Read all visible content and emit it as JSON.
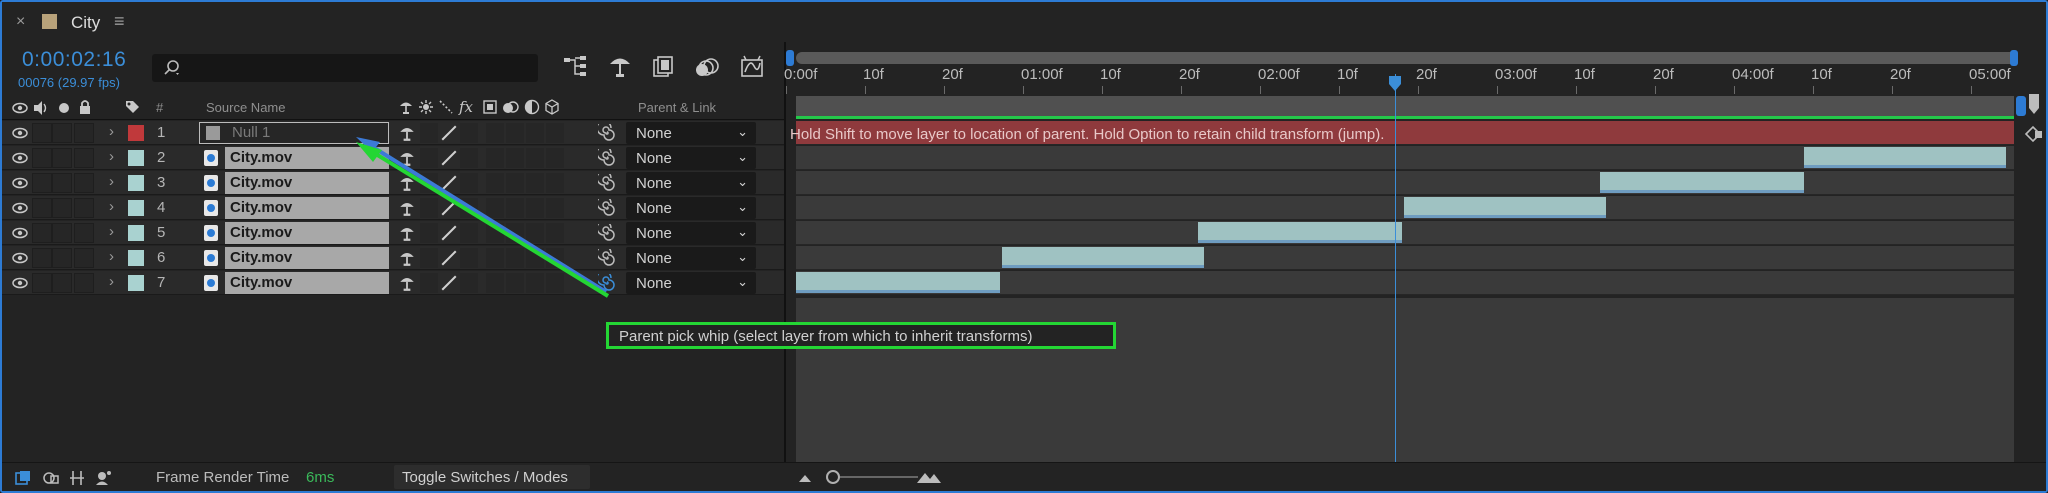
{
  "tab": {
    "close_glyph": "×",
    "title": "City",
    "menu_glyph": "≡",
    "swatch_color": "#b8a27a"
  },
  "timecode": {
    "time": "0:00:02:16",
    "frames_fps": "00076 (29.97 fps)"
  },
  "search": {
    "placeholder": ""
  },
  "columns": {
    "number": "#",
    "source_name": "Source Name",
    "parent_link": "Parent & Link"
  },
  "layers": [
    {
      "num": "1",
      "name": "Null 1",
      "label_color": "#c0393b",
      "type": "null",
      "parent": "None"
    },
    {
      "num": "2",
      "name": "City.mov",
      "label_color": "#a9d2d0",
      "type": "footage",
      "parent": "None"
    },
    {
      "num": "3",
      "name": "City.mov",
      "label_color": "#a9d2d0",
      "type": "footage",
      "parent": "None"
    },
    {
      "num": "4",
      "name": "City.mov",
      "label_color": "#a9d2d0",
      "type": "footage",
      "parent": "None"
    },
    {
      "num": "5",
      "name": "City.mov",
      "label_color": "#a9d2d0",
      "type": "footage",
      "parent": "None"
    },
    {
      "num": "6",
      "name": "City.mov",
      "label_color": "#a9d2d0",
      "type": "footage",
      "parent": "None"
    },
    {
      "num": "7",
      "name": "City.mov",
      "label_color": "#a9d2d0",
      "type": "footage",
      "parent": "None"
    }
  ],
  "ruler_labels": [
    "0:00f",
    "10f",
    "20f",
    "01:00f",
    "10f",
    "20f",
    "02:00f",
    "10f",
    "20f",
    "03:00f",
    "10f",
    "20f",
    "04:00f",
    "10f",
    "20f",
    "05:00f"
  ],
  "timeline_hint": "Hold Shift to move layer to location of parent. Hold Option to retain child transform (jump).",
  "tooltip": "Parent pick whip (select layer from which to inherit transforms)",
  "bottom": {
    "frame_render_label": "Frame Render Time",
    "frame_render_value": "6ms",
    "toggle_label": "Toggle Switches / Modes"
  },
  "colors": {
    "accent": "#2d7bd4",
    "highlight_green": "#24d634",
    "selected_row": "#8f3a3d",
    "clip": "#9fc2c2"
  }
}
